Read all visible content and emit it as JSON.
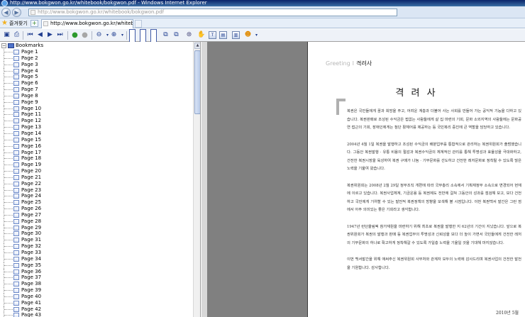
{
  "window": {
    "title": "http://www.bokgwon.go.kr/whitebook/bokgwon.pdf - Windows Internet Explorer"
  },
  "addressbar": {
    "url": "http://www.bokgwon.go.kr/whitebook/bokgwon.pdf"
  },
  "favorites": {
    "label": "즐겨찾기"
  },
  "tab": {
    "title": "http://www.bokgwon.go.kr/whitebook/bokg..."
  },
  "bookmarks": {
    "root_label": "Bookmarks",
    "items": [
      "Page 1",
      "Page 2",
      "Page 3",
      "Page 4",
      "Page 5",
      "Page 6",
      "Page 7",
      "Page 8",
      "Page 9",
      "Page 10",
      "Page 11",
      "Page 12",
      "Page 13",
      "Page 14",
      "Page 15",
      "Page 16",
      "Page 17",
      "Page 18",
      "Page 19",
      "Page 20",
      "Page 21",
      "Page 22",
      "Page 23",
      "Page 24",
      "Page 25",
      "Page 26",
      "Page 27",
      "Page 28",
      "Page 29",
      "Page 30",
      "Page 31",
      "Page 32",
      "Page 33",
      "Page 34",
      "Page 35",
      "Page 36",
      "Page 37",
      "Page 38",
      "Page 39",
      "Page 40",
      "Page 41",
      "Page 42",
      "Page 43"
    ]
  },
  "document": {
    "header_en": "Greeting",
    "header_sep": "I",
    "header_ko": "격려사",
    "title": "격 려 사",
    "paragraphs": [
      "복권은 국민들에게 꿈과 희망을 주고, 어려운 계층과 더불어 사는 사회를 만들어 가는 공익적 기능을 다하고 있습니다. 복권판매로 조성된 수익금은 접없는 사람들에게 살 집 마련의 기회, 문화 소외지역의 사람들에는 문화공연 접근의 기회, 장애인에게는 첨단 활체어를 제공하는 등 국민복리 증진에 큰 역할을 담당하고 있습니다.",
      "2004년 4월 1일 복권을 발행하고 조성된 수익금의 배분업무를 통합적으로 관리하는 복권위원회가 출범했습니다. 그동안 복권발행 · 유통 비용의 절감과 복권수익금의 체계적인 관리를 통해 투명성과 효율성을 극대화하고, 건전한 복권시장을 육성하여 복권 구매가 나눔 · 기부문화를 선도하고 건전한 레저문화로 정착될 수 있도록 많은 노력을 기울여 왔습니다.",
      "복권위원회는 2008년 2월 29일 정부조직 개편에 따라 국무총리 소속에서 기획재정부 소속으로 변경되어 현재에 이르고 있습니다. 복권사업체계, 기금운용 등 복권제도 전반에 걸쳐 그동안의 성과를 점검해 보고, 보다 건전하고 국민에게 기여할 수 있는 발전적 복권정책의 방향을 모색해 볼 시점입니다. 이번 복권백서 발간은 그런 점에서 아주 의미있는 좋은 기회라고 생각합니다.",
      "1947년 런던올림픽 참가재원을 마련하기 위해 최초로 복권을 발행한 지 62년의 기간이 지났습니다. 앞으로 복권위원회가 복권의 발행과 판매 등 복권업무의 투명성과 신뢰성을 보다 더 높이 가면서 국민들에게 건전한 레저의 기부문화의 하나로 확고하게 정착해갈 수 있도록 가일층 노력을 기울일 것을 기대해 마지않습니다.",
      "이번 백서발간을 위해 애써주신 복권위원회 사무처와 관계자 모두의 노력에 감사드리며 복권사업의 건전한 발전을 기원합니다. 감사합니다."
    ],
    "date": "2010년 5월"
  },
  "toolbar_icons": [
    "save-icon",
    "print-icon",
    "first-page-icon",
    "previous-page-icon",
    "next-page-icon",
    "last-page-icon",
    "go-back-icon",
    "go-forward-icon",
    "zoom-out-icon",
    "zoom-in-icon",
    "single-page-icon",
    "continuous-icon",
    "facing-icon",
    "rotate-icon",
    "find-icon",
    "hand-tool-icon",
    "text-select-icon",
    "snapshot-icon",
    "bookmarks-panel-icon",
    "help-icon"
  ]
}
